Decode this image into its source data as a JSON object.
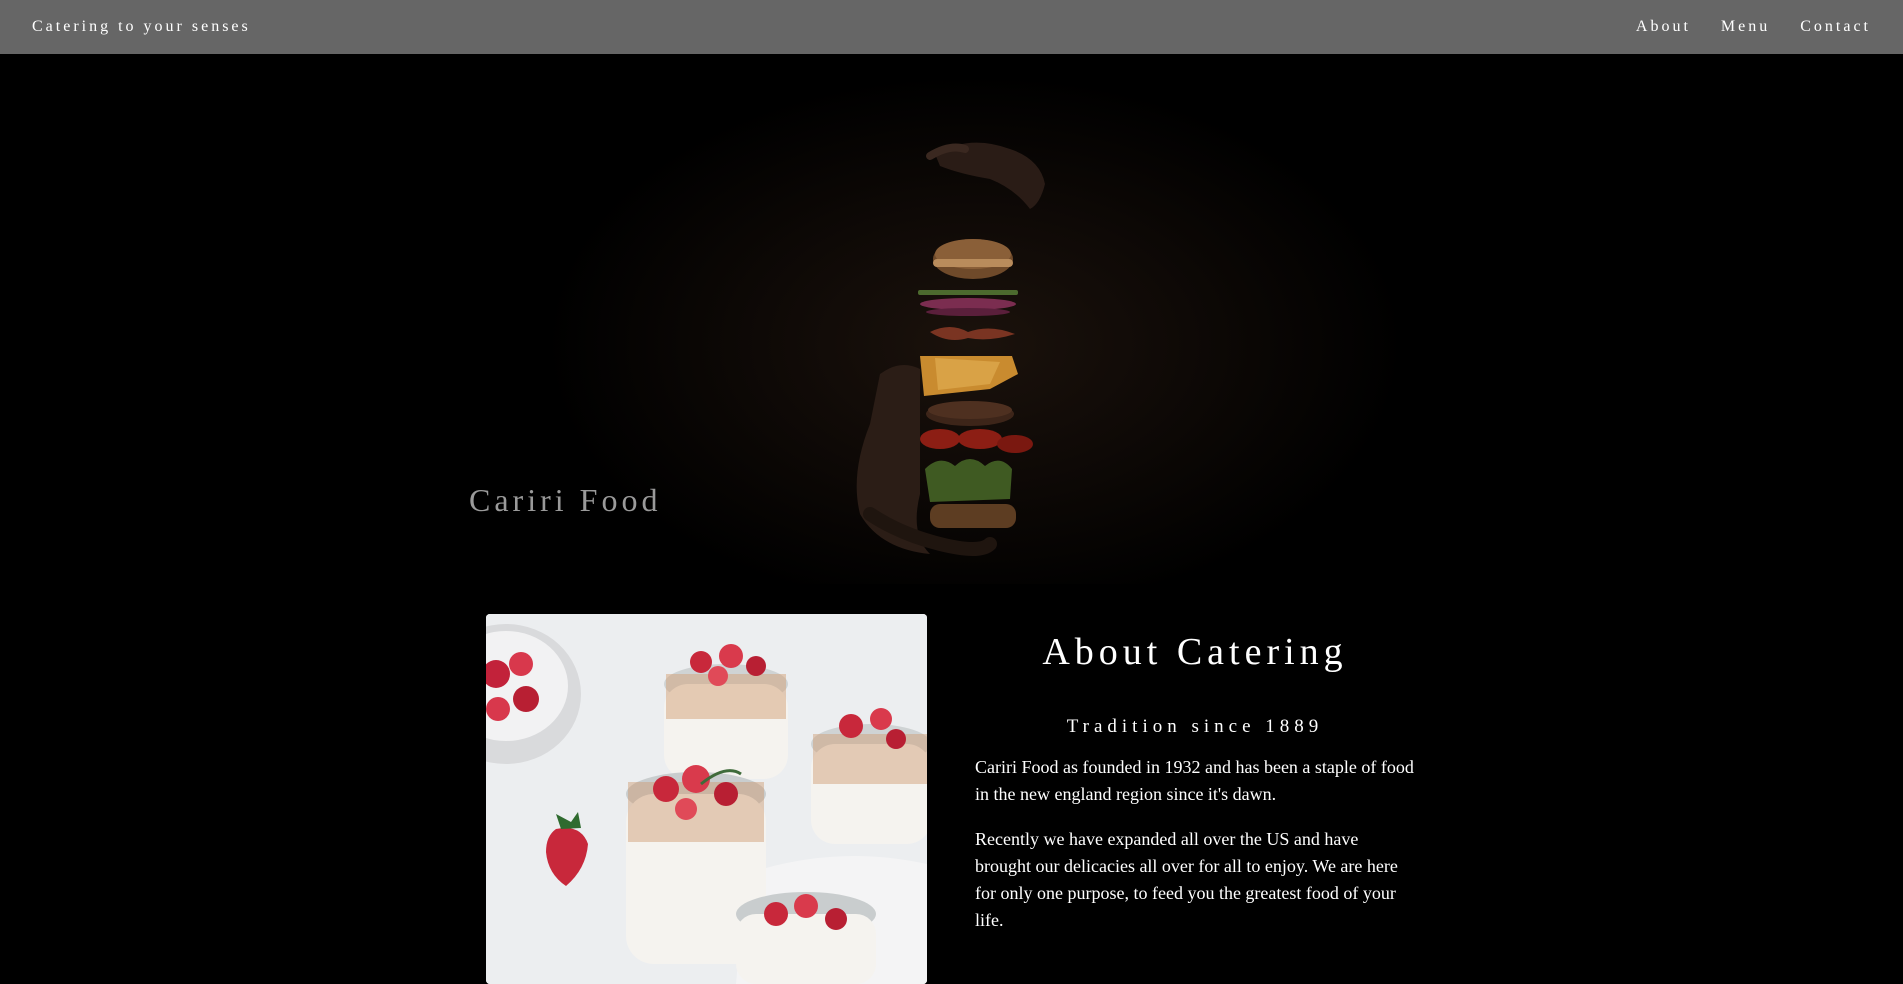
{
  "nav": {
    "brand": "Catering to your senses",
    "links": [
      {
        "label": "About"
      },
      {
        "label": "Menu"
      },
      {
        "label": "Contact"
      }
    ]
  },
  "hero": {
    "title": "Cariri Food"
  },
  "about": {
    "heading": "About Catering",
    "subheading": "Tradition since 1889",
    "paragraphs": [
      "Cariri Food as founded in 1932 and has been a staple of food in the new england region since it's dawn.",
      "Recently we have expanded all over the US and have brought our delicacies all over for all to enjoy. We are here for only one purpose, to feed you the greatest food of your life."
    ]
  },
  "colors": {
    "topbar": "#666666",
    "background": "#000000",
    "hero_title": "#9a9a9a",
    "text": "#ffffff"
  }
}
